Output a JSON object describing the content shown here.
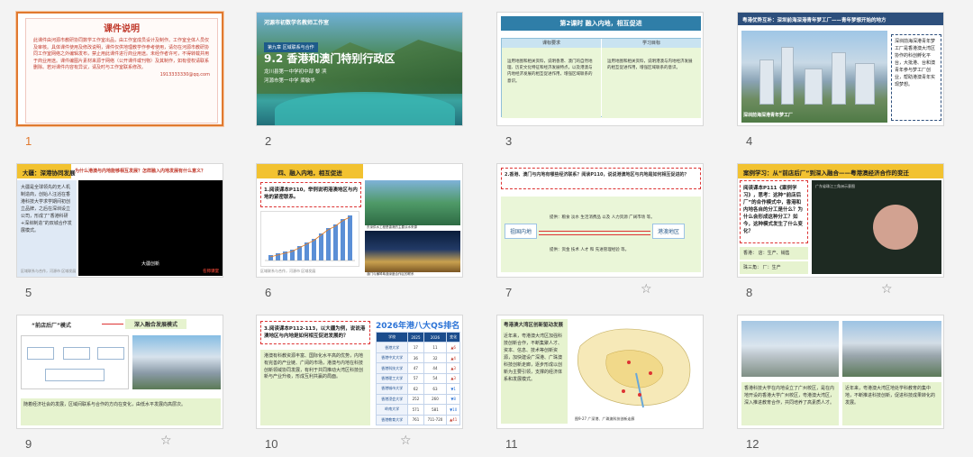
{
  "colors": {
    "accent": "#e0792f",
    "yellow_bar": "#f2c230",
    "green_box": "#e6f3cf",
    "blue_head": "#2f7ea8"
  },
  "slides": [
    {
      "number": "1",
      "title": "课件说明",
      "body": "此课件由河源市教研协同数学工作室出品，由工作室成员设计及制作。工作室全体人员仅及审核。具体课件使用及修改说明，课件仅供地理教学作参考使用，请勿在河源市教研协同工作室网络之外编辑发布，禁止用此课件进行商业用途。未经作者许可，不得转载并用于商业用途。课件编图片素材来源于网络（公开课件或刊物）及其制作，如有侵权请联系删除。若对课件内容有异议，请及时与工作室联系修改。",
      "contact": "1913333330@qq.com"
    },
    {
      "number": "2",
      "top": "河源市初数学名教师工作室",
      "badge": "第九章  区域联系与合作",
      "title": "9.2 香港和澳门特别行政区",
      "line1": "龙川县第一中学初中部  黎  滨",
      "line2": "河源市第一中学  梁敏华"
    },
    {
      "number": "3",
      "head": "第2课时  融入内地，相互促进",
      "col1": "课标要求",
      "col2": "学习目标",
      "cell1": "运用地图和相关资料，说明香港、澳门的自然地理、历史文化特征和经济发展特点，以及港澳与内地经济发展的相互促进作用，增强区域联系的意识。",
      "cell2": "运用地图和相关资料，说明港澳与内地经济发展的相互促进作用，增强区域联系的意识。"
    },
    {
      "number": "4",
      "head": "粤港优势互补：深圳前海深港青年梦工厂——青年梦想开始的地方",
      "caption": "深圳前海深港青年梦工厂",
      "note": "深圳前海深港青年梦工厂是香港澳大湾区协作的科创孵化平台，大批港、台和澳青年参与梦工厂创业，帮助港澳青年实现梦想。"
    },
    {
      "number": "5",
      "bar": "大疆：深港协同发展",
      "question": "为什么港澳与内地能够相互发展？怎样融入内地发展有什么意义？",
      "left": "大疆是全球领先的无人机制造商，创始人汪滔在香港科技大学求学期间初创立品牌，之后在深圳设立公司，形成了“香港科研+深圳制造”的双城合作发展模式。",
      "video": "大疆创新",
      "foot": "区域联系与合作，河源市  区域发展",
      "logo": "名师课堂"
    },
    {
      "number": "6",
      "bar": "四、融入内地，相互促进",
      "q": "1.阅读课本P110，举例说明港澳地区与内地的紧密联系。",
      "cap1": "东深供水工程是香港的主要淡水来源",
      "cap2": "澳门与横琴粤澳深度合作区的联系",
      "foot": "区域联系与合作，河源市  区域发展"
    },
    {
      "number": "7",
      "q": "2.香港、澳门与内地有哪些经济联系？阅读P110，说说港澳地区与内地是如何相互促进的？",
      "left": "祖国内地",
      "right": "港澳地区",
      "row1": "提供：粮食  淡水  生活消费品 以及 人力资源  广阔市场 等。",
      "row2": "提供：资金  技术  人才 和 先进管理经验 等。"
    },
    {
      "number": "8",
      "bar": "案例学习：从“前店后厂”到深入融合——粤港澳经济合作的变迁",
      "q": "阅读课本P111《案例学习》，思考：这种“前店后厂”的合作模式中，香港和内地各自的分工是什么？为什么会形成这种分工？如今，这种模式发生了什么变化？",
      "row1": "香港：  店：生产、销售",
      "row2": "珠三角：  厂：生产",
      "map": "广东省珠江三角洲示意图"
    },
    {
      "number": "9",
      "title": "“前店后厂”模式",
      "arrow": "深入融合发展模式",
      "text": "随着经济社会的发展，区域间联系与合作的方向在变化，由低水平发展向高层次。",
      "star": "☆"
    },
    {
      "number": "10",
      "q": "3.阅读课本P112-113，以大疆为例，说说港澳地区与内地是如何相互促进发展的？",
      "text": "港澳有科教资源丰富、国际化水平高的优势，内地有完善的产业链、广阔的市场，港澳与内地在科技创新领域协同发展，有利于共同推动大湾区科技创新与产业升级，形成互利共赢的局面。",
      "table_title": "2026年港八大",
      "table_title2": "QS排名",
      "table": [
        [
          "学校",
          "2025",
          "2026",
          "变化"
        ],
        [
          "香港大学",
          "17",
          "11",
          "▲6"
        ],
        [
          "香港中文大学",
          "36",
          "32",
          "▲4"
        ],
        [
          "香港科技大学",
          "47",
          "44",
          "▲3"
        ],
        [
          "香港理工大学",
          "57",
          "54",
          "▲3"
        ],
        [
          "香港城市大学",
          "62",
          "63",
          "▼1"
        ],
        [
          "香港浸会大学",
          "252",
          "260",
          "▼8"
        ],
        [
          "岭南大学",
          "571",
          "581",
          "▼10"
        ],
        [
          "香港教育大学",
          "761",
          "711-720",
          "▲41"
        ]
      ],
      "star": "☆"
    },
    {
      "number": "11",
      "title": "粤港澳大湾区创新驱动发展",
      "text": "近年来，粤港澳大湾区加强科技创新合作，不断集聚人才、资本、信息、技术等创新资源，加快建设广深港、广珠澳科技创新走廊，逐步形成以创新为主要引领，支撑的经济体系和发展模式。",
      "cap": "图9-27  广深港、广珠澳科技创新走廊"
    },
    {
      "number": "12",
      "t1": "香港科技大学在内地设立了广州校区，是在内地开设的香港大学广州校区，粤港澳大湾区，深入推进教育合作，共同培养了高素质人才。",
      "t2": "近年来，粤港澳大湾区地处学科教育的集中地，不断推进科技创新，促进科技成果转化的发展。"
    }
  ]
}
